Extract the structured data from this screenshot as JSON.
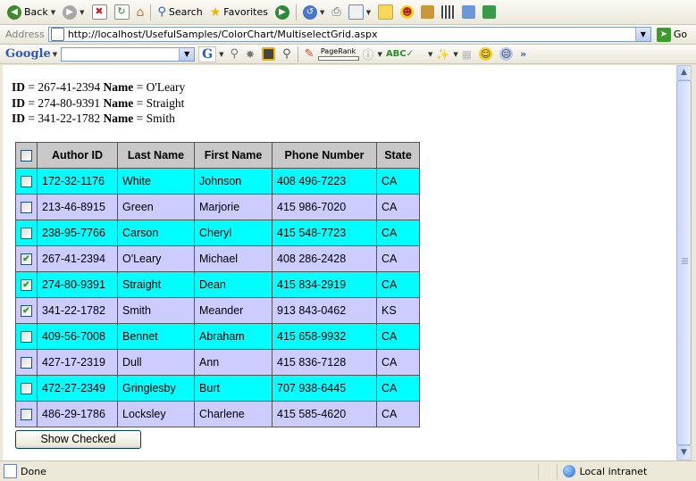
{
  "toolbar": {
    "back_label": "Back",
    "search_label": "Search",
    "favorites_label": "Favorites"
  },
  "address_bar": {
    "label": "Address",
    "url": "http://localhost/UsefulSamples/ColorChart/MultiselectGrid.aspx",
    "go_label": "Go"
  },
  "google_toolbar": {
    "logo": "Google",
    "search_value": "",
    "pagerank_label": "PageRank"
  },
  "selected_summary": [
    {
      "id_label": "ID",
      "id": "267-41-2394",
      "name_label": "Name",
      "name": "O'Leary"
    },
    {
      "id_label": "ID",
      "id": "274-80-9391",
      "name_label": "Name",
      "name": "Straight"
    },
    {
      "id_label": "ID",
      "id": "341-22-1782",
      "name_label": "Name",
      "name": "Smith"
    }
  ],
  "grid": {
    "headers": [
      "Author ID",
      "Last Name",
      "First Name",
      "Phone Number",
      "State"
    ],
    "rows": [
      {
        "checked": false,
        "author_id": "172-32-1176",
        "last": "White",
        "first": "Johnson",
        "phone": "408 496-7223",
        "state": "CA"
      },
      {
        "checked": false,
        "author_id": "213-46-8915",
        "last": "Green",
        "first": "Marjorie",
        "phone": "415 986-7020",
        "state": "CA"
      },
      {
        "checked": false,
        "author_id": "238-95-7766",
        "last": "Carson",
        "first": "Cheryl",
        "phone": "415 548-7723",
        "state": "CA"
      },
      {
        "checked": true,
        "author_id": "267-41-2394",
        "last": "O'Leary",
        "first": "Michael",
        "phone": "408 286-2428",
        "state": "CA"
      },
      {
        "checked": true,
        "author_id": "274-80-9391",
        "last": "Straight",
        "first": "Dean",
        "phone": "415 834-2919",
        "state": "CA"
      },
      {
        "checked": true,
        "author_id": "341-22-1782",
        "last": "Smith",
        "first": "Meander",
        "phone": "913 843-0462",
        "state": "KS"
      },
      {
        "checked": false,
        "author_id": "409-56-7008",
        "last": "Bennet",
        "first": "Abraham",
        "phone": "415 658-9932",
        "state": "CA"
      },
      {
        "checked": false,
        "author_id": "427-17-2319",
        "last": "Dull",
        "first": "Ann",
        "phone": "415 836-7128",
        "state": "CA"
      },
      {
        "checked": false,
        "author_id": "472-27-2349",
        "last": "Gringlesby",
        "first": "Burt",
        "phone": "707 938-6445",
        "state": "CA"
      },
      {
        "checked": false,
        "author_id": "486-29-1786",
        "last": "Locksley",
        "first": "Charlene",
        "phone": "415 585-4620",
        "state": "CA"
      }
    ],
    "row_colors": [
      "#00ffff",
      "#ccccff"
    ]
  },
  "show_button_label": "Show Checked",
  "status": {
    "text": "Done",
    "zone": "Local intranet"
  }
}
